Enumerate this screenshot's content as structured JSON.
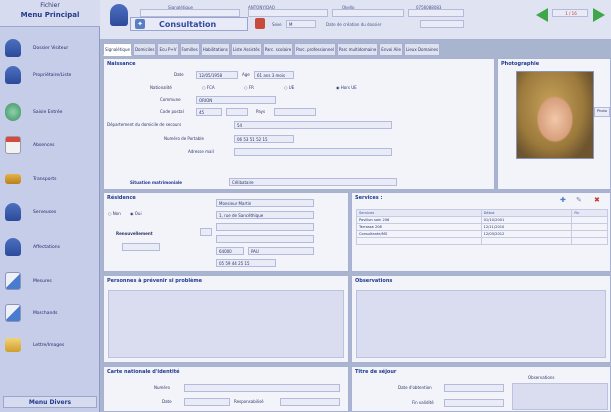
{
  "sidebar": {
    "title_top": "Fichier",
    "title": "Menu Principal",
    "items": [
      {
        "label": "Dossier Visiteur",
        "icon": "person-icon",
        "color": "#3e63b3"
      },
      {
        "label": "Propriétaire/Liste",
        "icon": "person-icon",
        "color": "#3e63b3"
      },
      {
        "label": "Saisie Entrée",
        "icon": "doctor-icon",
        "color": "#4a9f73"
      },
      {
        "label": "Absences",
        "icon": "calendar-icon",
        "color": "#c94a3e"
      },
      {
        "label": "Transports",
        "icon": "bus-icon",
        "color": "#d49a2a"
      },
      {
        "label": "Serveuses",
        "icon": "person-icon",
        "color": "#3e63b3"
      },
      {
        "label": "Affectations",
        "icon": "person-icon",
        "color": "#3e63b3"
      },
      {
        "label": "Mesures",
        "icon": "document-icon",
        "color": "#3d76c9"
      },
      {
        "label": "Marchands",
        "icon": "document-icon",
        "color": "#3d76c9"
      },
      {
        "label": "Lettre/Images",
        "icon": "folder-icon",
        "color": "#d4a52a"
      }
    ],
    "footer": "Menu Divers"
  },
  "topbar": {
    "mode": "Consultation",
    "label1": "Signalétique",
    "label2": "ANTONY/DAO",
    "label3": "Okello",
    "label4": "0756088083",
    "sexe_label": "Sexe",
    "sexe_value": "M",
    "date_label": "Date de création du dossier",
    "counter": "1 / 16"
  },
  "tabs": [
    "Signalétique",
    "Domiciles",
    "Ecu P+V",
    "Familles",
    "Habilitations",
    "Liste Assistés",
    "Parc. scolaire",
    "Parc. professionnel",
    "Parc multidomaine",
    "Envoi Aile",
    "Lieux Domaines"
  ],
  "naissance": {
    "title": "Naissance",
    "date_label": "Date",
    "date_value": "12/05/1958",
    "age_label": "Age",
    "age_value": "61 ans  3 mois",
    "nat_label": "Nationalité",
    "nat_opts": [
      "FCA",
      "FR",
      "UE",
      "Hors UE"
    ],
    "commune_label": "Commune",
    "commune_value": "ORION",
    "cp_label": "Code postal",
    "cp_value": "45",
    "pays_label": "Pays",
    "dept_label": "Département du domicile de secours",
    "dept_value": "54",
    "tel_label": "Numéro de Portable",
    "tel_value": "06 53 51 52 15",
    "mail_label": "Adresse mail",
    "situation_label": "Situation matrimoniale",
    "situation_value": "Célibataire"
  },
  "photo": {
    "title": "Photographie",
    "button": "Photo"
  },
  "residence": {
    "title": "Résidence",
    "opt1": "Non",
    "opt2": "Oui",
    "renouvellement_label": "Renouvellement",
    "name_value": "Monsieur Martin",
    "addr_value": "1, rue de Sancéthique",
    "cp_value": "64000",
    "city_value": "PAU",
    "phone_value": "05 59 44 25 15"
  },
  "services": {
    "title": "Services :",
    "headers": [
      "Services",
      "Début",
      "Fin"
    ],
    "rows": [
      [
        "Pavillon soin 206",
        "01/10/2001",
        ""
      ],
      [
        "Terrasse 208",
        "12/11/2010",
        ""
      ],
      [
        "Consultante/MS",
        "12/03/2012",
        ""
      ]
    ]
  },
  "personnes": {
    "title": "Personnes à prévenir si problème"
  },
  "observations": {
    "title": "Observations"
  },
  "cni": {
    "title": "Carte nationale d'identité",
    "numero_label": "Numéro",
    "date_label": "Date",
    "resp_label": "Responsabilisé"
  },
  "sejour": {
    "title": "Titre de séjour",
    "date_label": "Date d'obtention",
    "validite_label": "Fin validité",
    "obs_label": "Observations"
  }
}
